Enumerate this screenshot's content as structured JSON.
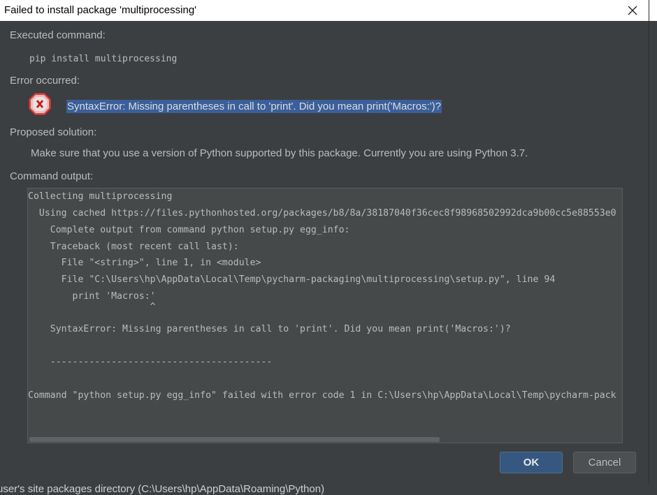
{
  "dialog": {
    "title": "Failed to install package 'multiprocessing'",
    "close_icon": "close-icon"
  },
  "sections": {
    "executed_label": "Executed command:",
    "command": "pip install multiprocessing",
    "error_label": "Error occurred:",
    "error_icon": "error-icon",
    "error_message": "SyntaxError: Missing parentheses in call to 'print'. Did you mean print('Macros:')?",
    "solution_label": "Proposed solution:",
    "solution": "Make sure that you use a version of Python supported by this package. Currently you are using Python 3.7.",
    "output_label": "Command output:"
  },
  "output": {
    "lines": [
      "Collecting multiprocessing",
      "  Using cached https://files.pythonhosted.org/packages/b8/8a/38187040f36cec8f98968502992dca9b00cc5e88553e0",
      "    Complete output from command python setup.py egg_info:",
      "    Traceback (most recent call last):",
      "      File \"<string>\", line 1, in <module>",
      "      File \"C:\\Users\\hp\\AppData\\Local\\Temp\\pycharm-packaging\\multiprocessing\\setup.py\", line 94",
      "        print 'Macros:'",
      "                      ^",
      "    SyntaxError: Missing parentheses in call to 'print'. Did you mean print('Macros:')?",
      "",
      "    ----------------------------------------",
      "",
      "Command \"python setup.py egg_info\" failed with error code 1 in C:\\Users\\hp\\AppData\\Local\\Temp\\pycharm-pack"
    ]
  },
  "buttons": {
    "ok": "OK",
    "cancel": "Cancel"
  },
  "background": {
    "text": "user's site packages directory (C:\\Users\\hp\\AppData\\Roaming\\Python)"
  }
}
